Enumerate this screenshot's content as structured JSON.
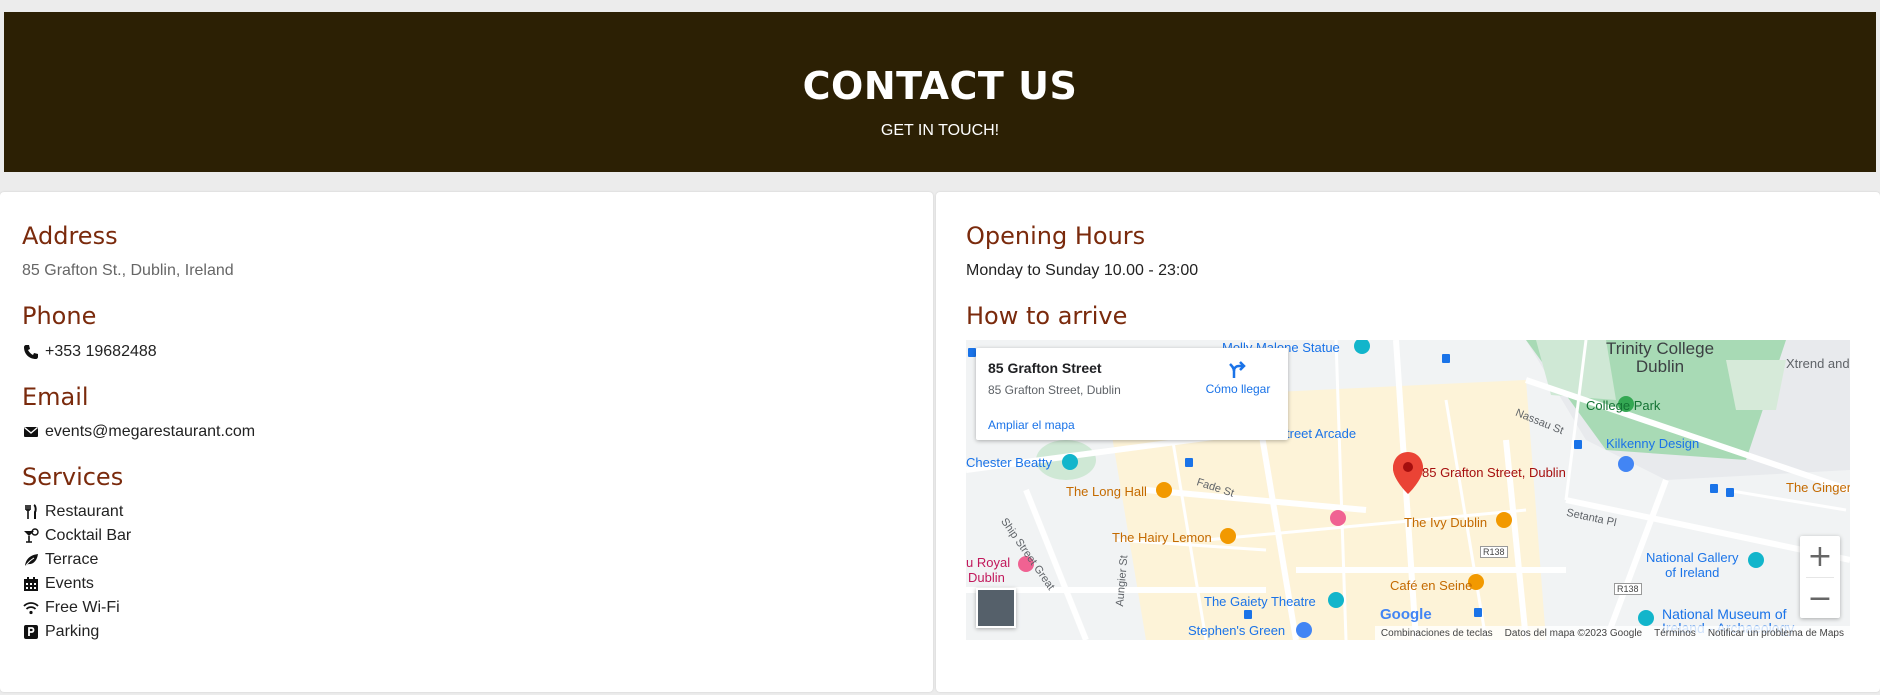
{
  "hero": {
    "title": "CONTACT US",
    "subtitle": "GET IN TOUCH!"
  },
  "left": {
    "address": {
      "heading": "Address",
      "value": "85 Grafton St., Dublin, Ireland"
    },
    "phone": {
      "heading": "Phone",
      "value": "+353 19682488",
      "icon": "phone-icon"
    },
    "email": {
      "heading": "Email",
      "value": "events@megarestaurant.com",
      "icon": "envelope-icon"
    },
    "services": {
      "heading": "Services",
      "items": [
        {
          "label": "Restaurant",
          "icon": "utensils-icon"
        },
        {
          "label": "Cocktail Bar",
          "icon": "cocktail-icon"
        },
        {
          "label": "Terrace",
          "icon": "leaf-icon"
        },
        {
          "label": "Events",
          "icon": "calendar-icon"
        },
        {
          "label": "Free Wi-Fi",
          "icon": "wifi-icon"
        },
        {
          "label": "Parking",
          "icon": "parking-icon"
        }
      ]
    }
  },
  "right": {
    "hours": {
      "heading": "Opening Hours",
      "value": "Monday to Sunday 10.00 - 23:00"
    },
    "arrive": {
      "heading": "How to arrive"
    }
  },
  "map": {
    "card": {
      "title": "85 Grafton Street",
      "address": "85 Grafton Street, Dublin",
      "directions": "Cómo llegar",
      "expand": "Ampliar el mapa"
    },
    "pin_label": "85 Grafton Street, Dublin",
    "labels": {
      "molly": "Molly Malone Statue",
      "trinity": "Trinity College\nDublin",
      "xtrend": "Xtrend and xtrend",
      "college_park": "College Park",
      "nassau": "Nassau St",
      "arcade": "treet Arcade",
      "kilkenny": "Kilkenny Design",
      "chester": "Chester Beatty",
      "long_hall": "The Long Hall",
      "fade": "Fade St",
      "ship": "Ship Street Great",
      "ivy": "The Ivy Dublin",
      "ginger": "The Ginger",
      "setanta": "Setanta Pl",
      "hairy": "The Hairy Lemon",
      "royal1": "u Royal",
      "royal2": "Dublin",
      "aungier": "Aungier St",
      "r138a": "R138",
      "r138b": "R138",
      "gallery": "National Gallery\nof Ireland",
      "cafe": "Café en Seine",
      "gaiety": "The Gaiety Theatre",
      "museum": "National Museum of",
      "museum2": "Ireland - Archaeology",
      "stephens": "Stephen's Green"
    },
    "google": "Google",
    "attribution": {
      "shortcuts": "Combinaciones de teclas",
      "data": "Datos del mapa ©2023 Google",
      "terms": "Términos",
      "report": "Notificar un problema de Maps"
    },
    "zoom_in": "+",
    "zoom_out": "−"
  },
  "colors": {
    "hero_bg": "#2c2004",
    "heading": "#7a2a0c"
  }
}
